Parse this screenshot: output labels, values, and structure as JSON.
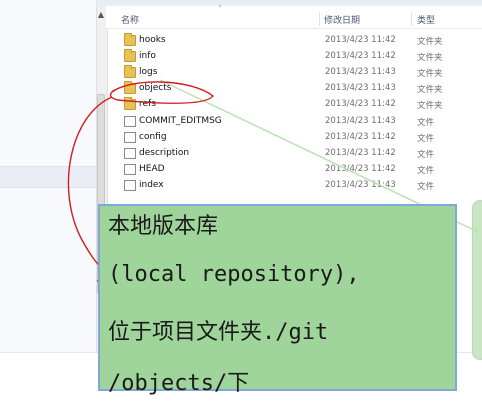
{
  "list": {
    "columns": {
      "name": "名称",
      "date": "修改日期",
      "type": "类型"
    },
    "rows": [
      {
        "name": "hooks",
        "date": "2013/4/23 11:42",
        "type": "文件夹",
        "kind": "folder-icon"
      },
      {
        "name": "info",
        "date": "2013/4/23 11:42",
        "type": "文件夹",
        "kind": "folder-icon"
      },
      {
        "name": "logs",
        "date": "2013/4/23 11:43",
        "type": "文件夹",
        "kind": "folder-icon"
      },
      {
        "name": "objects",
        "date": "2013/4/23 11:43",
        "type": "文件夹",
        "kind": "folder-icon"
      },
      {
        "name": "refs",
        "date": "2013/4/23 11:42",
        "type": "文件夹",
        "kind": "folder-icon"
      },
      {
        "name": "COMMIT_EDITMSG",
        "date": "2013/4/23 11:43",
        "type": "文件",
        "kind": "file-icon"
      },
      {
        "name": "config",
        "date": "2013/4/23 11:42",
        "type": "文件",
        "kind": "file-icon"
      },
      {
        "name": "description",
        "date": "2013/4/23 11:42",
        "type": "文件",
        "kind": "file-icon"
      },
      {
        "name": "HEAD",
        "date": "2013/4/23 11:42",
        "type": "文件",
        "kind": "file-icon"
      },
      {
        "name": "index",
        "date": "2013/4/23 11:43",
        "type": "文件",
        "kind": "file-icon"
      }
    ]
  },
  "annotation": {
    "lines": [
      "本地版本库",
      "(local repository),",
      "位于项目文件夹./git",
      "/objects/下"
    ],
    "box_color": "#9fd49a",
    "border_color": "#7ea8d6",
    "arrow_color": "#d11c1c"
  }
}
